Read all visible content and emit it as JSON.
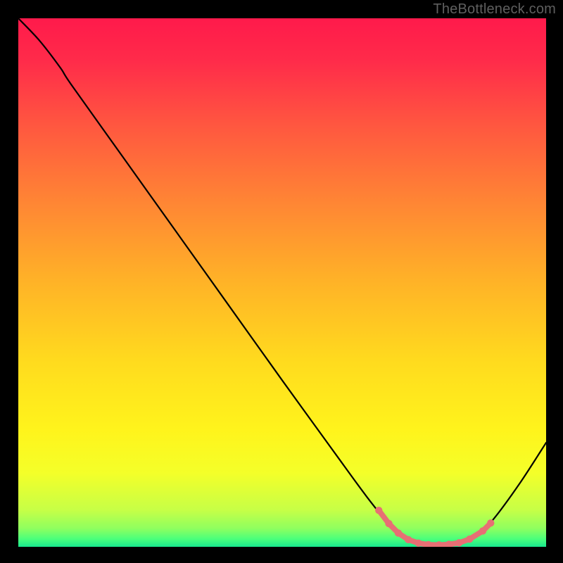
{
  "attribution": "TheBottleneck.com",
  "chart_data": {
    "type": "line",
    "title": "",
    "xlabel": "",
    "ylabel": "",
    "xlim": [
      0,
      100
    ],
    "ylim": [
      0,
      100
    ],
    "grid": false,
    "legend": false,
    "background_gradient": {
      "direction": "vertical",
      "stops": [
        {
          "offset": 0.0,
          "color": "#ff1a4b"
        },
        {
          "offset": 0.08,
          "color": "#ff2b4a"
        },
        {
          "offset": 0.2,
          "color": "#ff5640"
        },
        {
          "offset": 0.35,
          "color": "#ff8634"
        },
        {
          "offset": 0.5,
          "color": "#ffb327"
        },
        {
          "offset": 0.65,
          "color": "#ffdb1e"
        },
        {
          "offset": 0.78,
          "color": "#fff41c"
        },
        {
          "offset": 0.86,
          "color": "#f4ff29"
        },
        {
          "offset": 0.93,
          "color": "#c7ff46"
        },
        {
          "offset": 0.965,
          "color": "#8fff5f"
        },
        {
          "offset": 0.985,
          "color": "#4bff7b"
        },
        {
          "offset": 1.0,
          "color": "#18e78e"
        }
      ]
    },
    "series": [
      {
        "name": "bottleneck-curve",
        "stroke": "#000000",
        "stroke_width": 2.2,
        "points": [
          {
            "x": 0.0,
            "y": 100.0
          },
          {
            "x": 4.0,
            "y": 95.8
          },
          {
            "x": 8.0,
            "y": 90.6
          },
          {
            "x": 10.0,
            "y": 87.5
          },
          {
            "x": 20.0,
            "y": 73.5
          },
          {
            "x": 30.0,
            "y": 59.5
          },
          {
            "x": 40.0,
            "y": 45.5
          },
          {
            "x": 50.0,
            "y": 31.5
          },
          {
            "x": 60.0,
            "y": 17.7
          },
          {
            "x": 66.0,
            "y": 9.5
          },
          {
            "x": 70.0,
            "y": 4.6
          },
          {
            "x": 73.0,
            "y": 1.9
          },
          {
            "x": 76.0,
            "y": 0.65
          },
          {
            "x": 80.0,
            "y": 0.35
          },
          {
            "x": 84.0,
            "y": 0.85
          },
          {
            "x": 87.0,
            "y": 2.3
          },
          {
            "x": 90.0,
            "y": 5.2
          },
          {
            "x": 95.0,
            "y": 12.0
          },
          {
            "x": 100.0,
            "y": 19.7
          }
        ]
      },
      {
        "name": "optimal-band-markers",
        "stroke": "#e76f74",
        "stroke_width": 7.8,
        "marker_radius": 5.2,
        "points": [
          {
            "x": 68.3,
            "y": 6.9
          },
          {
            "x": 70.2,
            "y": 4.4
          },
          {
            "x": 72.0,
            "y": 2.6
          },
          {
            "x": 73.9,
            "y": 1.35
          },
          {
            "x": 75.8,
            "y": 0.7
          },
          {
            "x": 77.7,
            "y": 0.4
          },
          {
            "x": 79.7,
            "y": 0.35
          },
          {
            "x": 81.6,
            "y": 0.45
          },
          {
            "x": 83.5,
            "y": 0.75
          },
          {
            "x": 85.5,
            "y": 1.45
          },
          {
            "x": 88.0,
            "y": 3.0
          },
          {
            "x": 89.5,
            "y": 4.5
          }
        ]
      }
    ]
  }
}
